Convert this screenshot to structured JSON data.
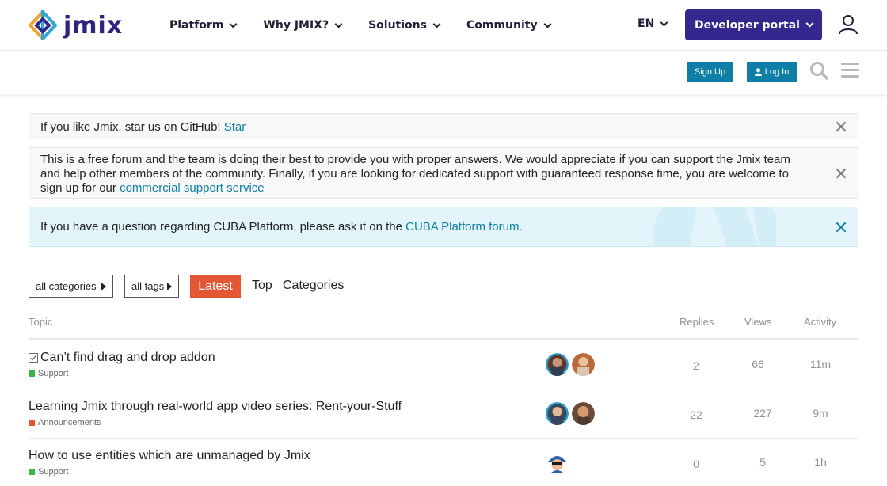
{
  "header": {
    "logo_text": "jmix",
    "nav": [
      "Platform",
      "Why JMIX?",
      "Solutions",
      "Community"
    ],
    "lang": "EN",
    "dev_portal": "Developer portal"
  },
  "forum_header": {
    "sign_up": "Sign Up",
    "log_in": "Log In"
  },
  "banners": {
    "github": {
      "text": "If you like Jmix, star us on GitHub!",
      "link": "Star"
    },
    "support": {
      "text": "This is a free forum and the team is doing their best to provide you with proper answers. We would appreciate if you can support the Jmix team and help other members of the community. Finally, if you are looking for dedicated support with guaranteed response time, you are welcome to sign up for our",
      "link": "commercial support service"
    },
    "cuba": {
      "text": "If you have a question regarding CUBA Platform, please ask it on the",
      "link": "CUBA Platform forum."
    }
  },
  "filters": {
    "categories": "all categories",
    "tags": "all tags",
    "tabs": [
      "Latest",
      "Top",
      "Categories"
    ]
  },
  "table": {
    "headers": {
      "topic": "Topic",
      "replies": "Replies",
      "views": "Views",
      "activity": "Activity"
    },
    "rows": [
      {
        "title": "Can’t find drag and drop addon",
        "category": "Support",
        "category_color": "#3ab54a",
        "solved": true,
        "replies": "2",
        "views": "66",
        "activity": "11m"
      },
      {
        "title": "Learning Jmix through real-world app video series: Rent-your-Stuff",
        "category": "Announcements",
        "category_color": "#e45735",
        "solved": false,
        "replies": "22",
        "views": "227",
        "activity": "9m"
      },
      {
        "title": "How to use entities which are unmanaged by Jmix",
        "category": "Support",
        "category_color": "#3ab54a",
        "solved": false,
        "replies": "0",
        "views": "5",
        "activity": "1h"
      }
    ]
  },
  "colors": {
    "brand": "#34288e",
    "accent": "#e45735",
    "link": "#0f7fa8"
  }
}
